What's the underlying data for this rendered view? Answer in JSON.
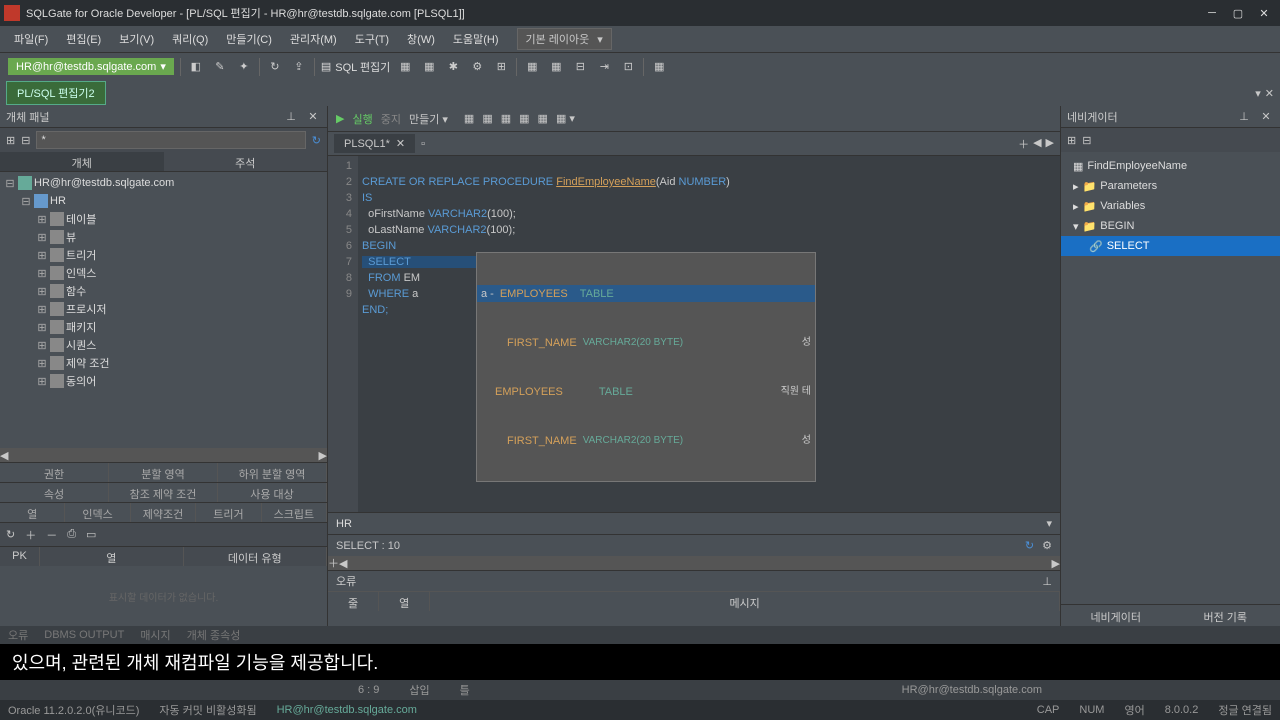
{
  "title": "SQLGate for Oracle Developer - [PL/SQL 편집기 - HR@hr@testdb.sqlgate.com [PLSQL1]]",
  "menu": {
    "file": "파일(F)",
    "edit": "편집(E)",
    "view": "보기(V)",
    "query": "쿼리(Q)",
    "make": "만들기(C)",
    "admin": "관리자(M)",
    "tool": "도구(T)",
    "window": "창(W)",
    "help": "도움말(H)",
    "layout": "기본 레이아웃"
  },
  "connection": "HR@hr@testdb.sqlgate.com",
  "sql_editor_label": "SQL 편집기",
  "file_tab": "PL/SQL 편집기2",
  "object_panel": {
    "title": "개체 패널",
    "filter": "*",
    "tab_object": "개체",
    "tab_comment": "주석"
  },
  "tree": {
    "root": "HR@hr@testdb.sqlgate.com",
    "user": "HR",
    "items": [
      "테이블",
      "뷰",
      "트리거",
      "인덱스",
      "함수",
      "프로시저",
      "패키지",
      "시퀀스",
      "제약 조건",
      "동의어"
    ]
  },
  "bottom_tabs": {
    "r1": [
      "권한",
      "분할 영역",
      "하위 분할 영역"
    ],
    "r2": [
      "속성",
      "참조 제약 조건",
      "사용 대상"
    ],
    "r3": [
      "열",
      "인덱스",
      "제약조건",
      "트리거",
      "스크립트"
    ]
  },
  "detail_cols": {
    "pk": "PK",
    "col": "열",
    "type": "데이터 유형"
  },
  "detail_empty": "표시할 데이터가 없습니다.",
  "editor_toolbar": {
    "run": "실행",
    "stop": "중지",
    "make": "만들기"
  },
  "editor_tab": "PLSQL1*",
  "code": {
    "l1a": "CREATE",
    "l1b": "OR",
    "l1c": "REPLACE",
    "l1d": "PROCEDURE",
    "l1e": "FindEmployeeName",
    "l1f": "(Aid",
    "l1g": "NUMBER",
    "l1h": ")",
    "l2": "IS",
    "l3a": "  oFirstName",
    "l3b": "VARCHAR2",
    "l3c": "(100);",
    "l4a": "  oLastName",
    "l4b": "VARCHAR2",
    "l4c": "(100);",
    "l5": "BEGIN",
    "l6": "  SELECT",
    "l7a": "  FROM",
    "l7b": "EM",
    "l8a": "  WHERE",
    "l8b": "a",
    "l9": "END;"
  },
  "autocomplete": {
    "r1": {
      "prefix": "a -",
      "name": "EMPLOYEES",
      "type": "TABLE"
    },
    "r2": {
      "name": "FIRST_NAME",
      "det": "VARCHAR2(20 BYTE)",
      "extra": "성"
    },
    "r3": {
      "name": "EMPLOYEES",
      "type": "TABLE",
      "extra": "직원 테"
    },
    "r4": {
      "name": "FIRST_NAME",
      "det": "VARCHAR2(20 BYTE)",
      "extra": "성"
    }
  },
  "schema": "HR",
  "select_status": "SELECT : 10",
  "error": {
    "title": "오류",
    "row": "줄",
    "col": "열",
    "msg": "메시지"
  },
  "navigator": {
    "title": "네비게이터",
    "items": [
      "FindEmployeeName",
      "Parameters",
      "Variables",
      "BEGIN",
      "SELECT"
    ],
    "tab1": "네비게이터",
    "tab2": "버전 기록"
  },
  "subtitle": "있으며, 관련된 개체 재컴파일 기능을 제공합니다.",
  "status2": {
    "pos": "6 : 9",
    "mode": "삽입",
    "t": "틀",
    "conn": "HR@hr@testdb.sqlgate.com"
  },
  "status": {
    "ver": "Oracle 11.2.0.2.0(유니코드)",
    "commit": "자동 커밋 비활성화됨",
    "conn": "HR@hr@testdb.sqlgate.com",
    "cap": "CAP",
    "num": "NUM",
    "lang": "영어",
    "v2": "8.0.0.2",
    "link": "정글 연결됨"
  },
  "error_tabs": [
    "오류",
    "DBMS OUTPUT",
    "매시지",
    "개체 종속성"
  ]
}
